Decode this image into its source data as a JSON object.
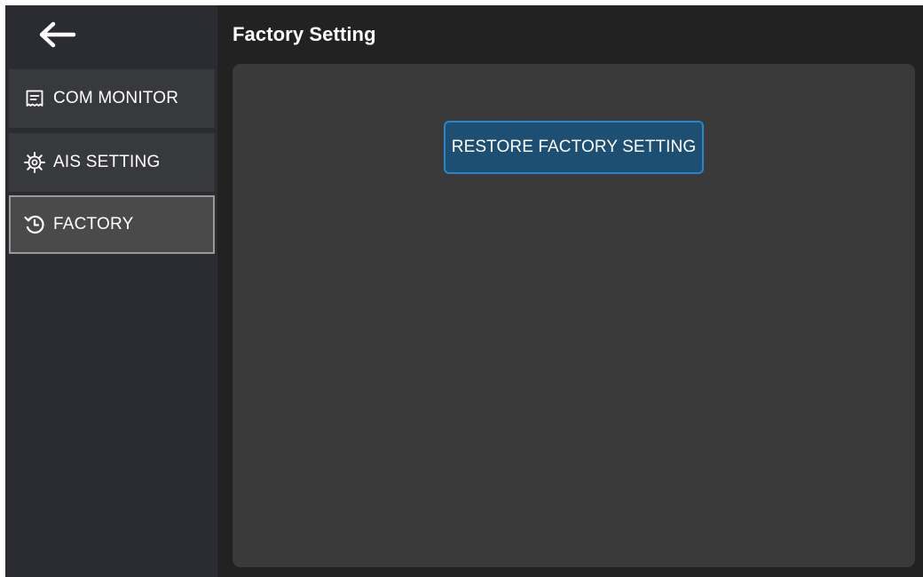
{
  "header": {
    "back_icon": "arrow-left-icon",
    "title": "Factory Setting"
  },
  "sidebar": {
    "items": [
      {
        "label": "COM MONITOR",
        "icon": "receipt-icon",
        "active": false
      },
      {
        "label": "AIS SETTING",
        "icon": "gear-icon",
        "active": false
      },
      {
        "label": "FACTORY",
        "icon": "history-icon",
        "active": true
      }
    ]
  },
  "main": {
    "restore_button_label": "RESTORE FACTORY SETTING"
  },
  "colors": {
    "background": "#222222",
    "sidebar": "#2b2c31",
    "panel": "#3a3a3a",
    "accent": "#2a86c6"
  }
}
